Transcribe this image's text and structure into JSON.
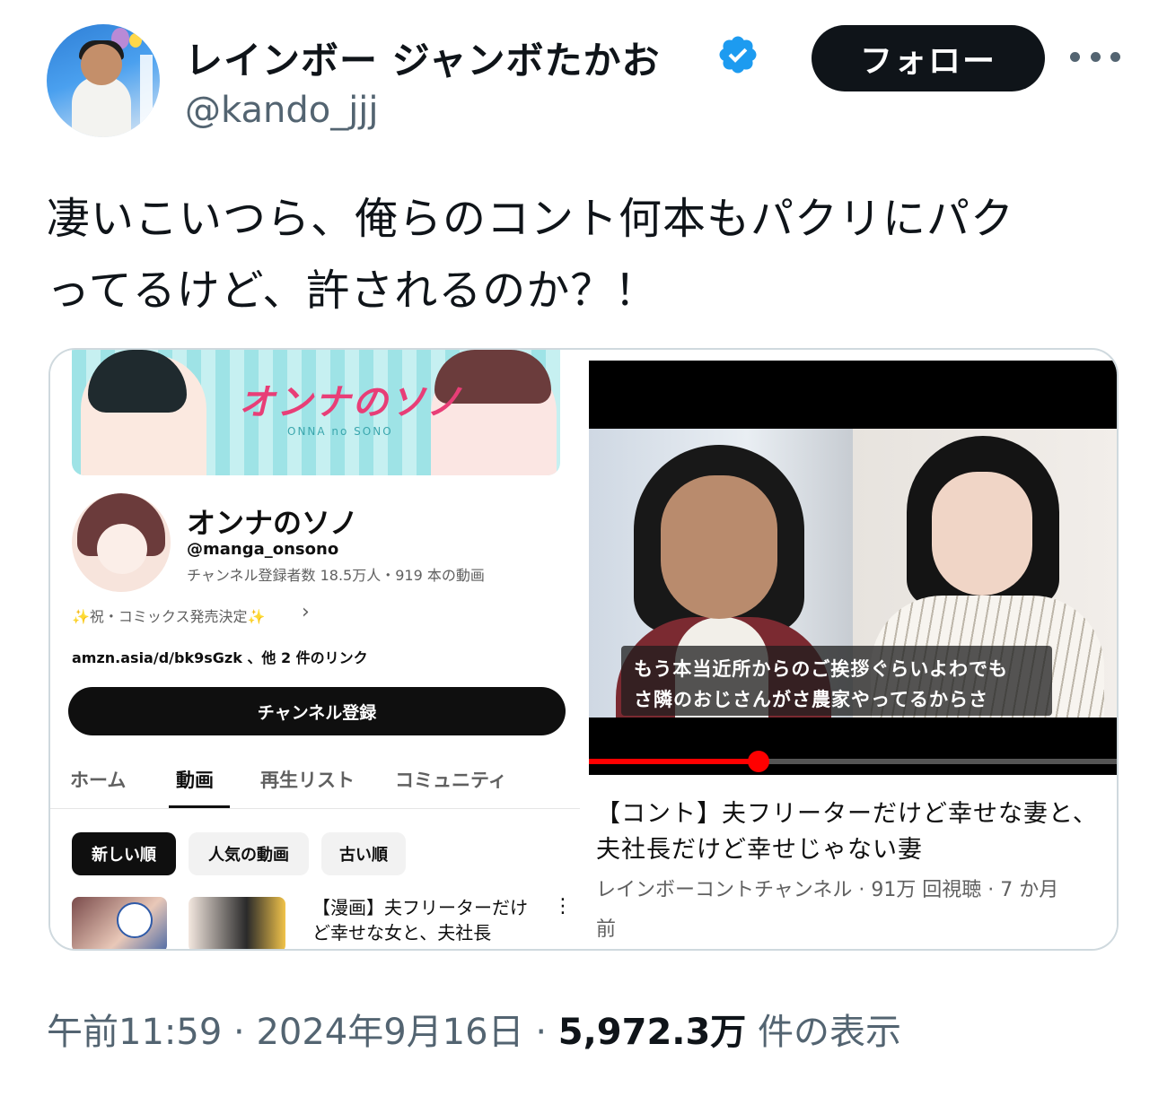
{
  "author": {
    "name": "レインボー ジャンボたかお",
    "handle": "@kando_jjj",
    "verified": true,
    "verified_color": "#1d9bf0"
  },
  "follow_label": "フォロー",
  "more_icon": "more-horizontal-icon",
  "tweet": {
    "line1": "凄いこいつら、俺らのコント何本もパクリにパク",
    "line2": "ってるけど、許されるのか？！"
  },
  "youtube_channel": {
    "banner_title": "オンナのソノ",
    "banner_sub": "ONNA no SONO",
    "name": "オンナのソノ",
    "handle": "@manga_onsono",
    "stats": "チャンネル登録者数 18.5万人・919 本の動画",
    "promo": "✨祝・コミックス発売決定✨",
    "link": "amzn.asia/d/bk9sGzk 、他 2 件のリンク",
    "subscribe_label": "チャンネル登録",
    "tabs": [
      "ホーム",
      "動画",
      "再生リスト",
      "コミュニティ"
    ],
    "active_tab": "動画",
    "chips": [
      "新しい順",
      "人気の動画",
      "古い順"
    ],
    "video_title": "【漫画】夫フリーターだけど幸せな女と、夫社長"
  },
  "youtube_video": {
    "subtitle_line1": "もう本当近所からのご挨拶ぐらいよわでも",
    "subtitle_line2": "さ隣のおじさんがさ農家やってるからさ",
    "progress": 0.32,
    "title": "【コント】夫フリーターだけど幸せな妻と、夫社長だけど幸せじゃない妻",
    "meta": "レインボーコントチャンネル · 91万 回視聴 · 7 か月",
    "meta_cont": "前"
  },
  "footer": {
    "time": "午前11:59",
    "date": "2024年9月16日",
    "views": "5,972.3万",
    "views_suffix": "件の表示"
  }
}
